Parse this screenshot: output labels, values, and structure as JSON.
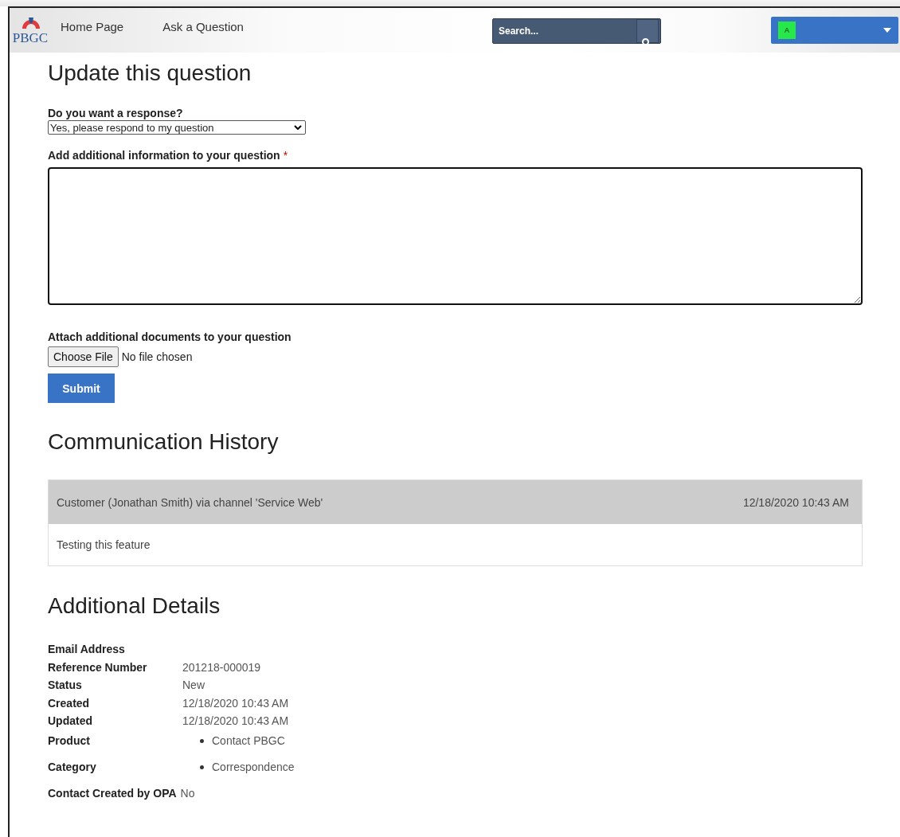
{
  "header": {
    "logo_text": "PBGC",
    "nav": [
      {
        "label": "Home Page"
      },
      {
        "label": "Ask a Question"
      }
    ],
    "search": {
      "placeholder": "Search..."
    },
    "user_menu": {
      "avatar_letter": "A"
    }
  },
  "update_form": {
    "title": "Update this question",
    "response": {
      "label": "Do you want a response?",
      "value": "Yes, please respond to my question"
    },
    "additional_info": {
      "label": "Add additional information to your question",
      "required_mark": "*"
    },
    "attachment": {
      "label": "Attach additional documents to your question",
      "button": "Choose File",
      "status": "No file chosen"
    },
    "submit": "Submit"
  },
  "communication_history": {
    "title": "Communication History",
    "entries": [
      {
        "author": "Customer (Jonathan Smith) via channel 'Service Web'",
        "time": "12/18/2020 10:43 AM",
        "message": "Testing this feature"
      }
    ]
  },
  "additional_details": {
    "title": "Additional Details",
    "rows": [
      {
        "label": "Email Address",
        "kind": "text"
      },
      {
        "label": "Reference Number",
        "kind": "text",
        "value": "201218-000019"
      },
      {
        "label": "Status",
        "kind": "text",
        "value": "New"
      },
      {
        "label": "Created",
        "kind": "text",
        "value": "12/18/2020 10:43 AM"
      },
      {
        "label": "Updated",
        "kind": "text",
        "value": "12/18/2020 10:43 AM"
      },
      {
        "label": "Product",
        "kind": "list",
        "items": [
          "Contact PBGC"
        ]
      },
      {
        "label": "Category",
        "kind": "list",
        "items": [
          "Correspondence"
        ]
      },
      {
        "label": "Contact Created by OPA",
        "kind": "inline",
        "value": "No"
      }
    ]
  }
}
